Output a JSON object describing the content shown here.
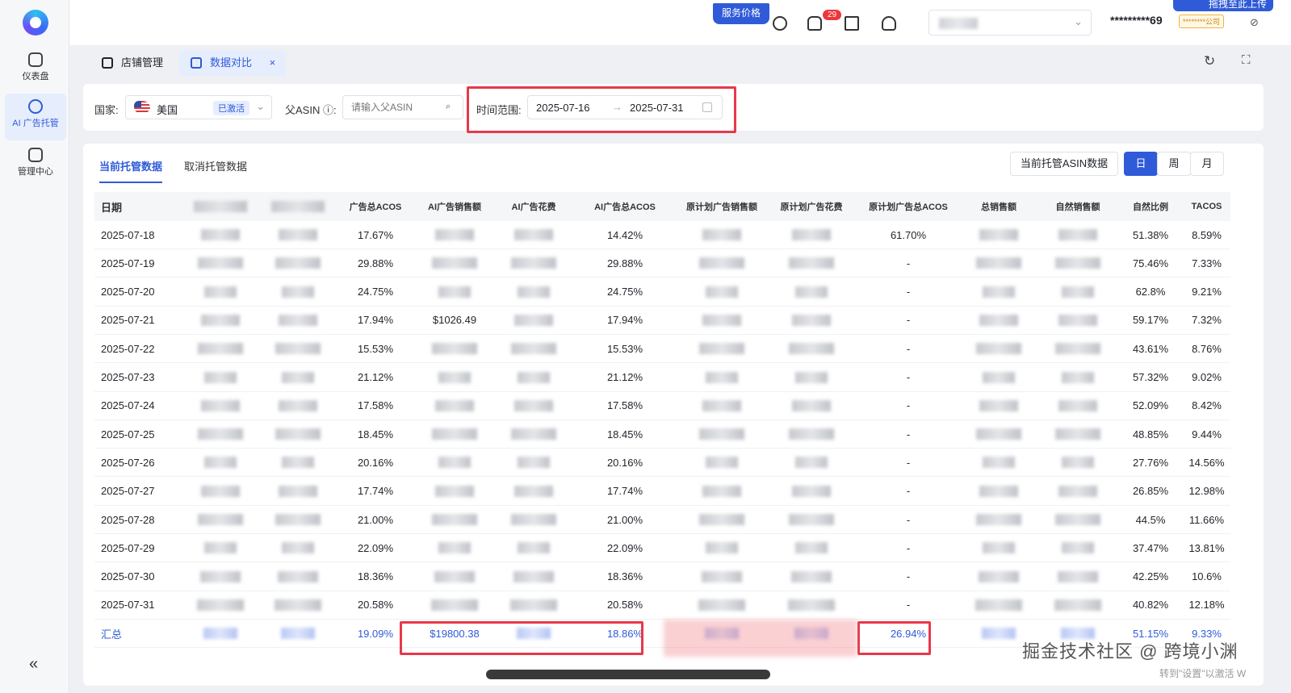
{
  "sidebar": {
    "items": [
      {
        "label": "仪表盘",
        "icon": "dashboard-icon"
      },
      {
        "label": "AI 广告托管",
        "icon": "ai-ad-icon"
      },
      {
        "label": "管理中心",
        "icon": "management-icon"
      }
    ],
    "collapse": "«"
  },
  "topbar": {
    "service_price": "服务价格",
    "notification_count": "29",
    "account": "*********69",
    "company": "********公司",
    "upload": "拖拽至此上传"
  },
  "tabs": [
    {
      "label": "店铺管理"
    },
    {
      "label": "数据对比",
      "close": "×"
    }
  ],
  "filters": {
    "country_label": "国家:",
    "country_value": "美国",
    "country_status": "已激活",
    "asin_label": "父ASIN ⓘ:",
    "asin_placeholder": "请输入父ASIN",
    "time_label": "时间范围:",
    "date_start": "2025-07-16",
    "date_arrow": "→",
    "date_end": "2025-07-31"
  },
  "subtabs": {
    "current": "当前托管数据",
    "cancelled": "取消托管数据"
  },
  "controls": {
    "asin_data": "当前托管ASIN数据",
    "day": "日",
    "week": "周",
    "month": "月"
  },
  "table": {
    "headers": [
      "日期",
      "",
      "",
      "广告总ACOS",
      "AI广告销售额",
      "AI广告花费",
      "AI广告总ACOS",
      "原计划广告销售额",
      "原计划广告花费",
      "原计划广告总ACOS",
      "总销售额",
      "自然销售额",
      "自然比例",
      "TACOS"
    ],
    "rows": [
      {
        "date": "2025-07-18",
        "acos": "17.67%",
        "ai_sales": "",
        "ai_acos": "14.42%",
        "orig_acos": "61.70%",
        "natural_ratio": "51.38%",
        "tacos": "8.59%"
      },
      {
        "date": "2025-07-19",
        "acos": "29.88%",
        "ai_sales": "",
        "ai_acos": "29.88%",
        "orig_acos": "-",
        "natural_ratio": "75.46%",
        "tacos": "7.33%"
      },
      {
        "date": "2025-07-20",
        "acos": "24.75%",
        "ai_sales": "",
        "ai_acos": "24.75%",
        "orig_acos": "-",
        "natural_ratio": "62.8%",
        "tacos": "9.21%"
      },
      {
        "date": "2025-07-21",
        "acos": "17.94%",
        "ai_sales": "$1026.49",
        "ai_acos": "17.94%",
        "orig_acos": "-",
        "natural_ratio": "59.17%",
        "tacos": "7.32%"
      },
      {
        "date": "2025-07-22",
        "acos": "15.53%",
        "ai_sales": "",
        "ai_acos": "15.53%",
        "orig_acos": "-",
        "natural_ratio": "43.61%",
        "tacos": "8.76%"
      },
      {
        "date": "2025-07-23",
        "acos": "21.12%",
        "ai_sales": "",
        "ai_acos": "21.12%",
        "orig_acos": "-",
        "natural_ratio": "57.32%",
        "tacos": "9.02%"
      },
      {
        "date": "2025-07-24",
        "acos": "17.58%",
        "ai_sales": "",
        "ai_acos": "17.58%",
        "orig_acos": "-",
        "natural_ratio": "52.09%",
        "tacos": "8.42%"
      },
      {
        "date": "2025-07-25",
        "acos": "18.45%",
        "ai_sales": "",
        "ai_acos": "18.45%",
        "orig_acos": "-",
        "natural_ratio": "48.85%",
        "tacos": "9.44%"
      },
      {
        "date": "2025-07-26",
        "acos": "20.16%",
        "ai_sales": "",
        "ai_acos": "20.16%",
        "orig_acos": "-",
        "natural_ratio": "27.76%",
        "tacos": "14.56%"
      },
      {
        "date": "2025-07-27",
        "acos": "17.74%",
        "ai_sales": "",
        "ai_acos": "17.74%",
        "orig_acos": "-",
        "natural_ratio": "26.85%",
        "tacos": "12.98%"
      },
      {
        "date": "2025-07-28",
        "acos": "21.00%",
        "ai_sales": "",
        "ai_acos": "21.00%",
        "orig_acos": "-",
        "natural_ratio": "44.5%",
        "tacos": "11.66%"
      },
      {
        "date": "2025-07-29",
        "acos": "22.09%",
        "ai_sales": "",
        "ai_acos": "22.09%",
        "orig_acos": "-",
        "natural_ratio": "37.47%",
        "tacos": "13.81%"
      },
      {
        "date": "2025-07-30",
        "acos": "18.36%",
        "ai_sales": "",
        "ai_acos": "18.36%",
        "orig_acos": "-",
        "natural_ratio": "42.25%",
        "tacos": "10.6%"
      },
      {
        "date": "2025-07-31",
        "acos": "20.58%",
        "ai_sales": "",
        "ai_acos": "20.58%",
        "orig_acos": "-",
        "natural_ratio": "40.82%",
        "tacos": "12.18%"
      }
    ],
    "total": {
      "date": "汇总",
      "acos": "19.09%",
      "ai_sales": "$19800.38",
      "ai_acos": "18.86%",
      "orig_acos": "26.94%",
      "natural_ratio": "51.15%",
      "tacos": "9.33%"
    }
  },
  "watermark": "掘金技术社区 @ 跨境小渊",
  "windows_notice": "转到\"设置\"以激活 W"
}
